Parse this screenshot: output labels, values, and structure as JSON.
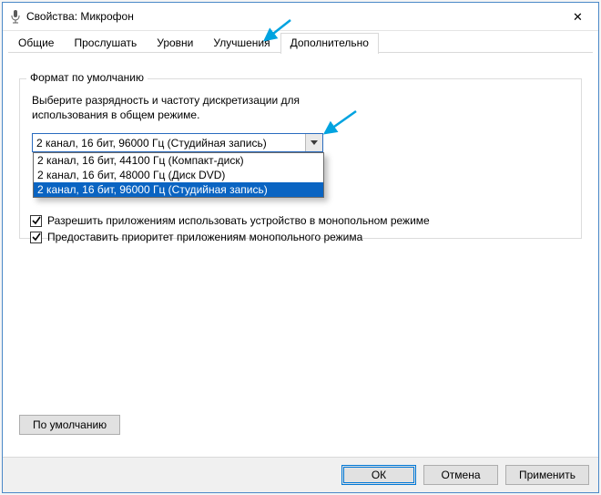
{
  "window": {
    "title": "Свойства: Микрофон"
  },
  "tabs": {
    "items": [
      {
        "label": "Общие"
      },
      {
        "label": "Прослушать"
      },
      {
        "label": "Уровни"
      },
      {
        "label": "Улучшения"
      },
      {
        "label": "Дополнительно"
      }
    ],
    "active_index": 4
  },
  "default_format": {
    "group_label": "Формат по умолчанию",
    "description": "Выберите разрядность и частоту дискретизации для использования в общем режиме.",
    "selected": "2 канал, 16 бит, 96000 Гц (Студийная запись)",
    "options": [
      "2 канал, 16 бит, 44100 Гц (Компакт-диск)",
      "2 канал, 16 бит, 48000 Гц (Диск DVD)",
      "2 канал, 16 бит, 96000 Гц (Студийная запись)"
    ],
    "highlight_index": 2
  },
  "exclusive": {
    "allow_label": "Разрешить приложениям использовать устройство в монопольном режиме",
    "allow_checked": true,
    "priority_label": "Предоставить приоритет приложениям монопольного режима",
    "priority_checked": true
  },
  "buttons": {
    "defaults": "По умолчанию",
    "ok": "ОК",
    "cancel": "Отмена",
    "apply": "Применить"
  },
  "colors": {
    "window_border": "#4a88c7",
    "selection": "#0a64c2",
    "annotation_arrow": "#00a3e0"
  }
}
